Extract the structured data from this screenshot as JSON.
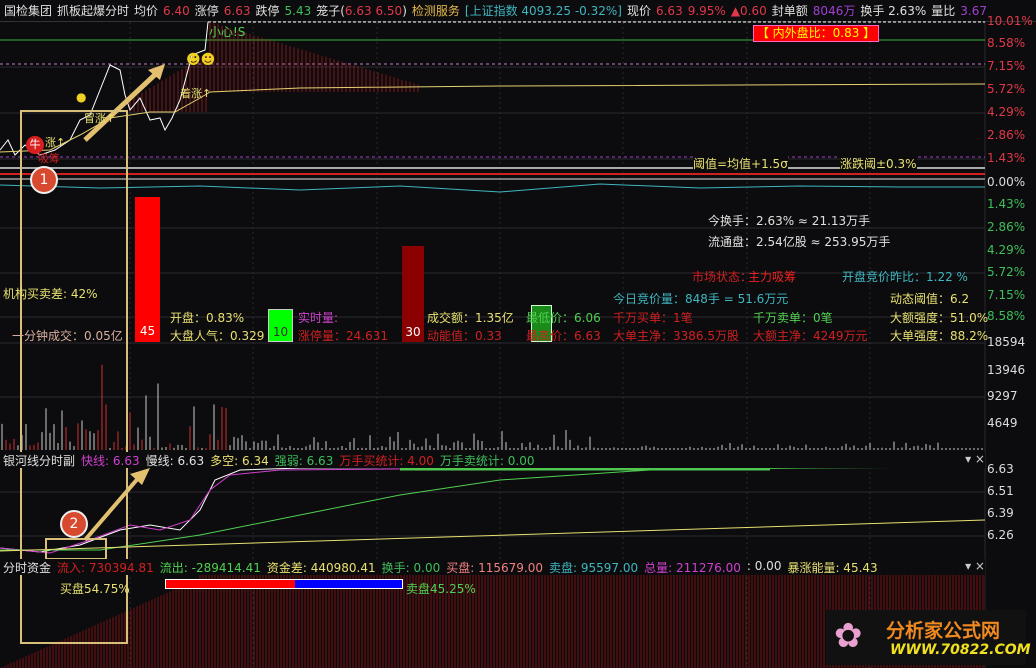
{
  "header": {
    "stock": "国检集团",
    "formula": "抓板起爆分时",
    "avg_label": "均价",
    "avg": "6.40",
    "limit_up_label": "涨停",
    "limit_up": "6.63",
    "limit_down_label": "跌停",
    "limit_down": "5.43",
    "cage_label": "笼子(",
    "cage_vals": "6.63 6.50",
    "cage_end": ")",
    "industry": "检测服务",
    "index": "[上证指数 4093.25 -0.32%]",
    "price_label": "现价",
    "price": "6.63",
    "pct": "9.95%",
    "change": "▲0.60",
    "seal_label": "封单额",
    "seal": "8046万",
    "turnover": "换手 2.63%",
    "vr_label": "量比",
    "vr": "3.67"
  },
  "price_axis": [
    "10.01%",
    "8.58%",
    "7.15%",
    "5.72%",
    "4.29%",
    "2.86%",
    "1.43%",
    "0.00%",
    "1.43%",
    "2.86%",
    "4.29%",
    "5.72%",
    "7.15%",
    "8.58%"
  ],
  "vol_axis": [
    "18594",
    "13946",
    "9297",
    "4649"
  ],
  "ind_axis": [
    "6.63",
    "6.51",
    "6.39",
    "6.26"
  ],
  "chart_labels": {
    "caution": "小心!S",
    "ratio": "【 内外盘比：0.83 】",
    "threshold": "阈值=均值+1.5σ",
    "updown": "涨跌阈±0.3%",
    "bull": "牛",
    "zhang1": "涨↑",
    "zhang2": "冒涨↑",
    "zhang3": "着涨↑",
    "xichou": "吸筹",
    "c1": "1",
    "c2": "2"
  },
  "stats": {
    "turnover": "今换手：2.63% ≈ 21.13万手",
    "float": "流通盘：2.54亿股 ≈ 253.95万手",
    "market_state_label": "市场状态：",
    "market_state": "主力吸筹",
    "open_bid_ratio": "开盘竞价昨比：1.22  %",
    "bid_vol": "今日竞价量：848手 = 51.6万元",
    "dyn_threshold": "动态阈值：6.2",
    "inst_diff": "机构买卖差: 42%",
    "min_vol": "一分钟成交：0.05亿",
    "bar1": "45",
    "open": "开盘：0.83%",
    "popularity": "大盘人气：0.329",
    "bar2": "10",
    "realtime_label": "实时量:",
    "limitup_vol": "涨停量：24.631",
    "bar3": "30",
    "amount": "成交额：1.35亿",
    "momentum": "动能值：0.33",
    "low": "最低价：6.06",
    "high": "最高价：6.63",
    "big_buy": "千万买单：1笔",
    "big_sell": "千万卖单：0笔",
    "big_net": "大单主净：3386.5万股",
    "amt_net": "大额主净：4249万元",
    "amt_strength": "大额强度：51.0%",
    "order_strength": "大单强度：88.2%"
  },
  "indicator": {
    "title": "银河线分时副",
    "fast": "快线: 6.63",
    "slow": "慢线: 6.63",
    "ls": "多空: 6.34",
    "strength": "强弱: 6.63",
    "buy_stat": "万手买统计: 4.00",
    "sell_stat": "万手卖统计: 0.00"
  },
  "funds": {
    "title": "分时资金",
    "inflow": "流入: 730394.81",
    "outflow": "流出: -289414.41",
    "diff": "资金差: 440980.41",
    "turnover": "换手: 0.00",
    "buy": "买盘: 115679.00",
    "sell": "卖盘: 95597.00",
    "total": "总量: 211276.00",
    "blank": ": 0.00",
    "surge": "暴涨能量: 45.43",
    "buy_pct": "买盘54.75%",
    "sell_pct": "卖盘45.25%",
    "buy_fraction": 0.5475
  },
  "watermark": {
    "name": "分析家公式网",
    "url": "WWW.70822.COM"
  }
}
